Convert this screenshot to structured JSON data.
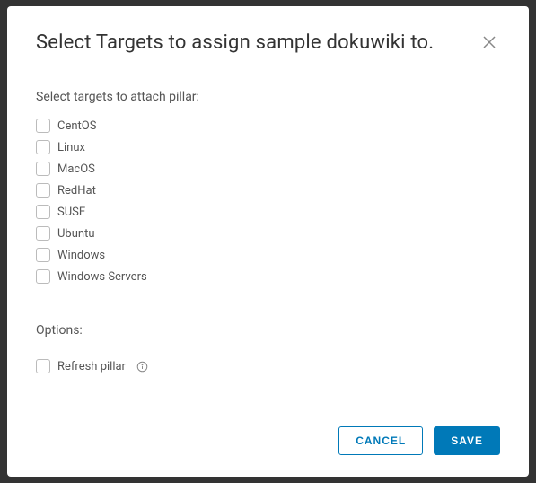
{
  "modal": {
    "title": "Select Targets to assign sample dokuwiki to.",
    "targets_label": "Select targets to attach pillar:",
    "options_label": "Options:",
    "targets": [
      {
        "label": "CentOS"
      },
      {
        "label": "Linux"
      },
      {
        "label": "MacOS"
      },
      {
        "label": "RedHat"
      },
      {
        "label": "SUSE"
      },
      {
        "label": "Ubuntu"
      },
      {
        "label": "Windows"
      },
      {
        "label": "Windows Servers"
      }
    ],
    "refresh_label": "Refresh pillar",
    "cancel_label": "CANCEL",
    "save_label": "SAVE"
  }
}
